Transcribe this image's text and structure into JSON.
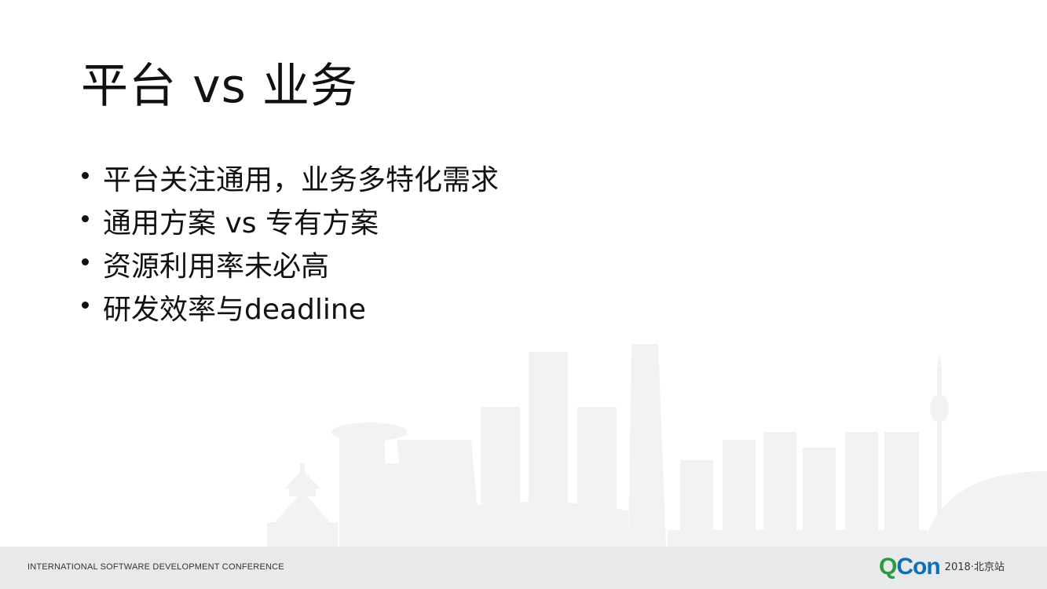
{
  "slide": {
    "title": "平台 vs 业务",
    "bullets": [
      "平台关注通用，业务多特化需求",
      "通用方案 vs 专有方案",
      "资源利用率未必高",
      "研发效率与deadline"
    ]
  },
  "footer": {
    "conference_name": "INTERNATIONAL SOFTWARE DEVELOPMENT CONFERENCE",
    "logo_q": "Q",
    "logo_con": "Con",
    "edition": "2018·北京站"
  },
  "colors": {
    "skyline": "#f1f2f3",
    "footer_bg": "#e8e9eb",
    "logo_green": "#2a9a41",
    "logo_blue": "#0e6fb8"
  }
}
